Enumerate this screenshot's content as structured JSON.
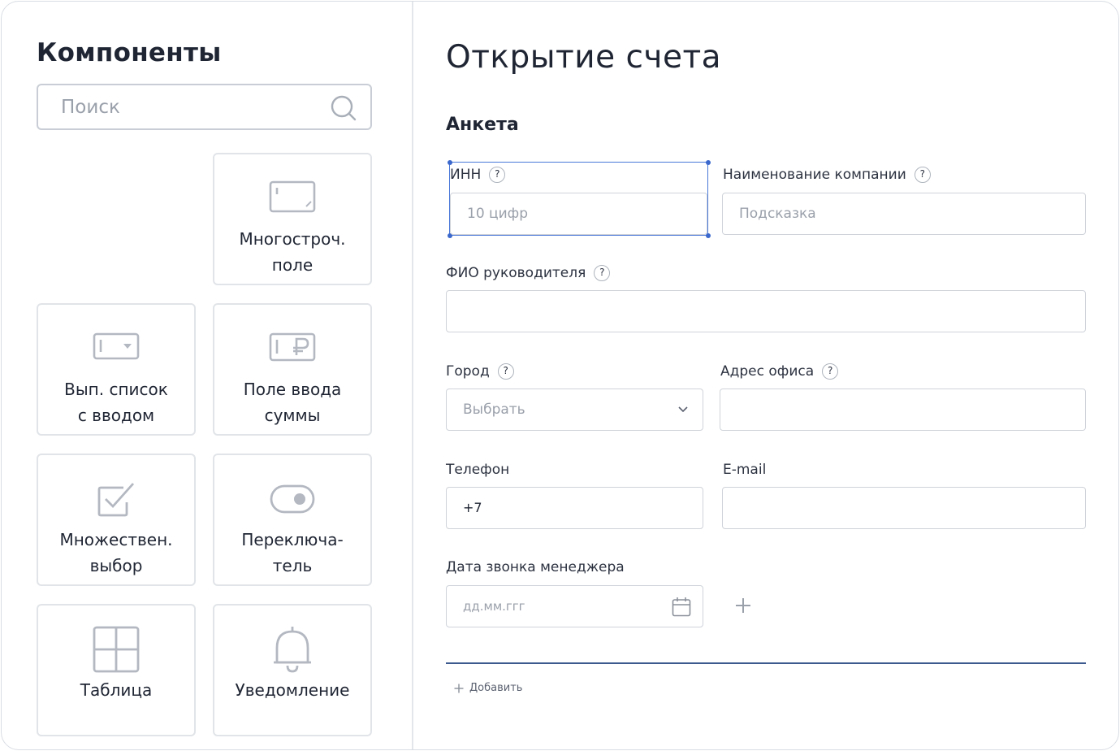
{
  "sidebar": {
    "title": "Компоненты",
    "search_placeholder": "Поиск",
    "tiles": [
      {
        "icon": "multiline-field-icon",
        "line1": "Многостроч.",
        "line2": "поле"
      },
      {
        "icon": "combobox-icon",
        "line1": "Вып. список",
        "line2": "с вводом"
      },
      {
        "icon": "amount-field-icon",
        "line1": "Поле ввода",
        "line2": "суммы"
      },
      {
        "icon": "checkbox-icon",
        "line1": "Множествен.",
        "line2": "выбор"
      },
      {
        "icon": "toggle-icon",
        "line1": "Переключа-",
        "line2": "тель"
      },
      {
        "icon": "table-icon",
        "line1": "Таблица"
      },
      {
        "icon": "bell-icon",
        "line1": "Уведомление"
      }
    ]
  },
  "main": {
    "title": "Открытие счета",
    "section": "Анкета",
    "help_mark": "?",
    "fields": {
      "inn": {
        "label": "ИНН",
        "placeholder": "10 цифр"
      },
      "company": {
        "label": "Наименование компании",
        "placeholder": "Подсказка"
      },
      "director": {
        "label": "ФИО руководителя"
      },
      "city": {
        "label": "Город",
        "placeholder": "Выбрать"
      },
      "address": {
        "label": "Адрес офиса"
      },
      "phone": {
        "label": "Телефон",
        "value": "+7"
      },
      "email": {
        "label": "E-mail"
      },
      "call_date": {
        "label": "Дата звонка менеджера",
        "placeholder": "дд.мм.ггг"
      }
    },
    "add_label": "Добавить"
  },
  "colors": {
    "selection": "#4a78d8",
    "separator": "#3d5a8f",
    "icon_gray": "#b3b8c1"
  }
}
